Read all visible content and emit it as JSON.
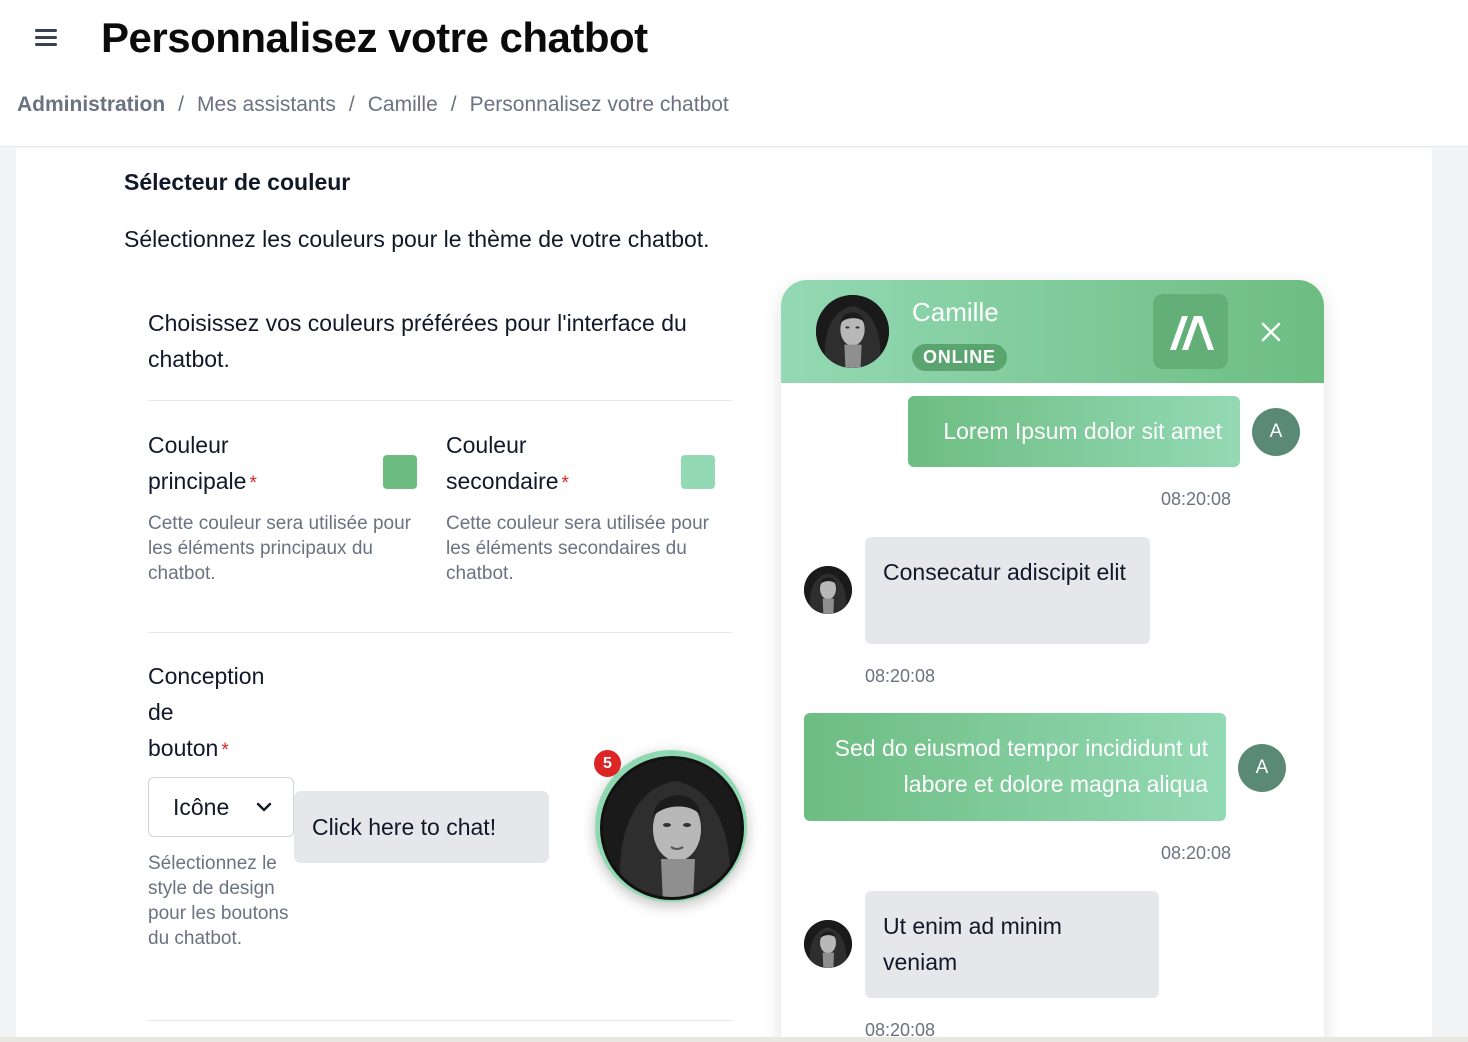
{
  "header": {
    "title": "Personnalisez votre chatbot",
    "breadcrumb": [
      "Administration",
      "Mes assistants",
      "Camille",
      "Personnalisez votre chatbot"
    ]
  },
  "section": {
    "title": "Sélecteur de couleur",
    "description": "Sélectionnez les couleurs pour le thème de votre chatbot.",
    "intro": "Choisissez vos couleurs préférées pour l'interface du chatbot."
  },
  "colors": {
    "primary": {
      "label_line1": "Couleur",
      "label_line2": "principale",
      "required": "*",
      "help": "Cette couleur sera utilisée pour les éléments principaux du chatbot.",
      "value": "#6dbd82"
    },
    "secondary": {
      "label_line1": "Couleur",
      "label_line2": "secondaire",
      "required": "*",
      "help": "Cette couleur sera utilisée pour les éléments secondaires du chatbot.",
      "value": "#93d9b4"
    }
  },
  "button_design": {
    "label_line1": "Conception",
    "label_line2": "de",
    "label_line3": "bouton",
    "required": "*",
    "selected": "Icône",
    "help": "Sélectionnez le style de design pour les boutons du chatbot.",
    "preview_text": "Click here to chat!",
    "badge_count": "5"
  },
  "widget": {
    "name": "Camille",
    "status": "ONLINE",
    "logo_icon": "brand-logo-icon",
    "close_icon": "close-icon",
    "messages": [
      {
        "from": "user",
        "text": "Lorem Ipsum dolor sit amet",
        "initial": "A",
        "time": "08:20:08"
      },
      {
        "from": "bot",
        "text": "Consecatur adiscipit elit",
        "time": "08:20:08"
      },
      {
        "from": "user",
        "text": "Sed do eiusmod tempor incididunt ut labore et dolore magna aliqua",
        "initial": "A",
        "time": "08:20:08"
      },
      {
        "from": "bot",
        "text": "Ut enim ad minim veniam",
        "time": "08:20:08"
      }
    ]
  }
}
